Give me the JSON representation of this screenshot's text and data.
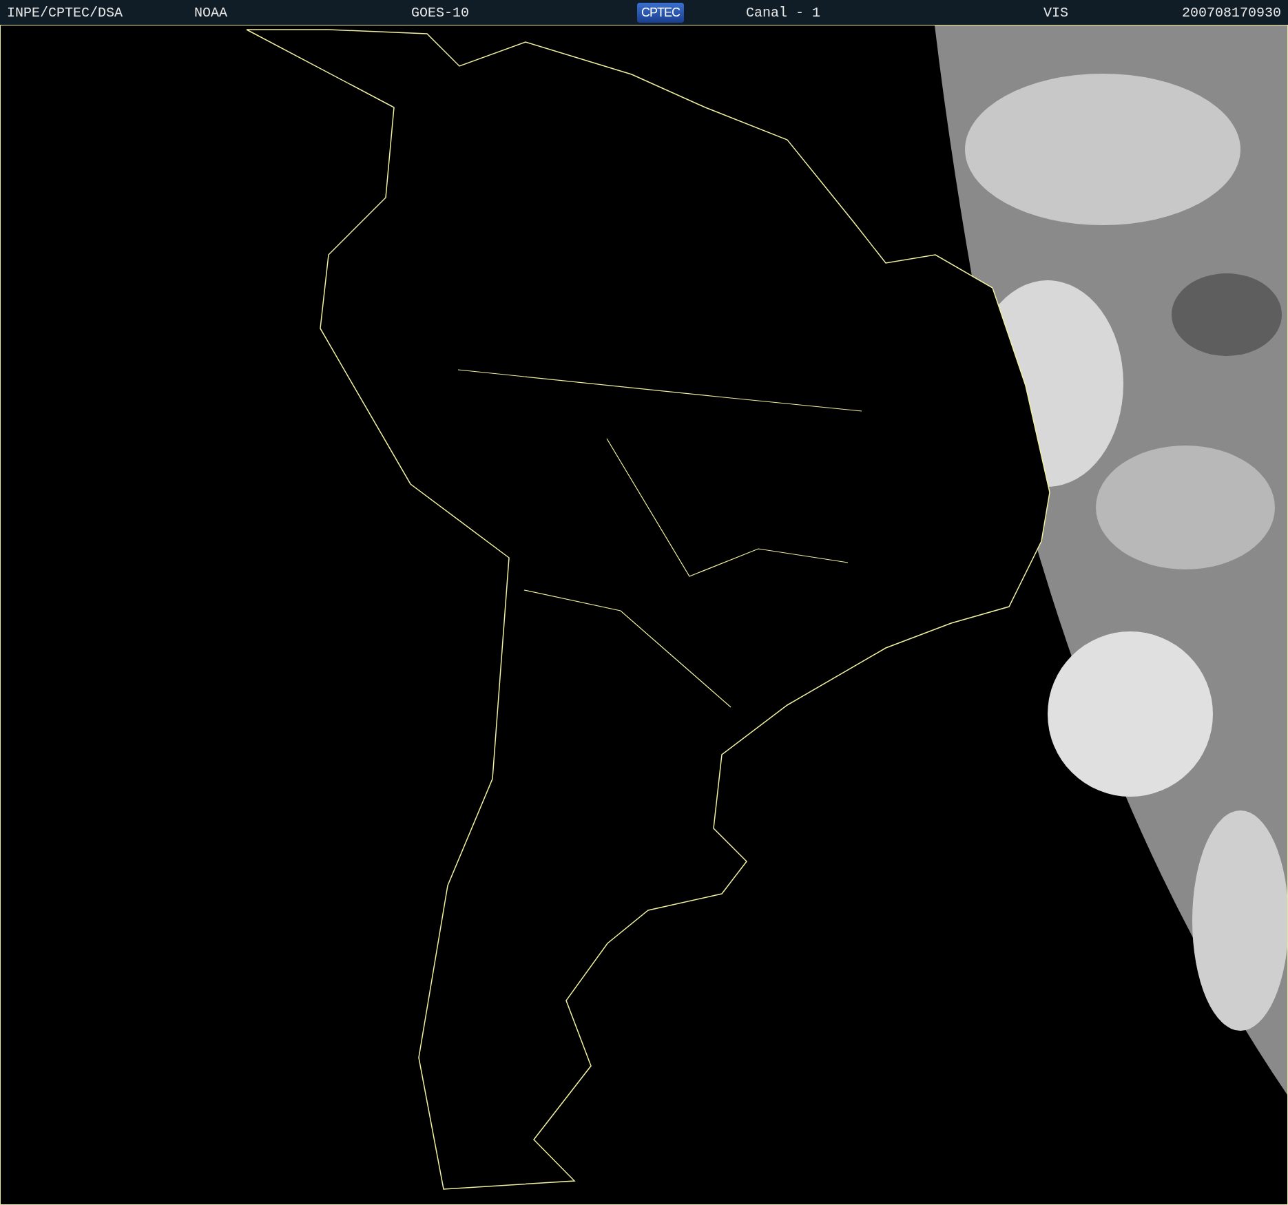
{
  "header": {
    "items": [
      {
        "kind": "text",
        "text": "INPE/CPTEC/DSA"
      },
      {
        "kind": "text",
        "text": "NOAA"
      },
      {
        "kind": "text",
        "text": "GOES-10"
      },
      {
        "kind": "logo",
        "text": "CPTEC"
      },
      {
        "kind": "text",
        "text": "Canal - 1"
      },
      {
        "kind": "text",
        "text": "VIS"
      },
      {
        "kind": "text",
        "text": "200708170930"
      }
    ]
  }
}
